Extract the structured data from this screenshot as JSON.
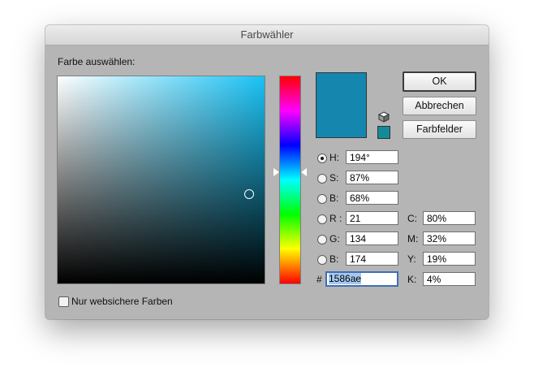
{
  "window": {
    "title": "Farbwähler"
  },
  "picker": {
    "label": "Farbe auswählen:"
  },
  "buttons": {
    "ok": "OK",
    "cancel": "Abbrechen",
    "swatches": "Farbfelder"
  },
  "colors": {
    "current": "#1586ae",
    "web_safe": "#158a9a",
    "hue_base": "#19c2f5"
  },
  "hsb": {
    "h_label": "H:",
    "h_value": "194°",
    "s_label": "S:",
    "s_value": "87%",
    "b_label": "B:",
    "b_value": "68%"
  },
  "rgb": {
    "r_label": "R :",
    "r_value": "21",
    "g_label": "G:",
    "g_value": "134",
    "b_label": "B:",
    "b_value": "174"
  },
  "cmyk": {
    "c_label": "C:",
    "c_value": "80%",
    "m_label": "M:",
    "m_value": "32%",
    "y_label": "Y:",
    "y_value": "19%",
    "k_label": "K:",
    "k_value": "4%"
  },
  "hex": {
    "label": "#",
    "value": "1586ae"
  },
  "websafe": {
    "label": "Nur websichere Farben"
  },
  "icons": {
    "cube": "web-safe-cube-icon",
    "marker": "color-marker-icon",
    "hue_arrows": "hue-slider-arrow-icon"
  }
}
